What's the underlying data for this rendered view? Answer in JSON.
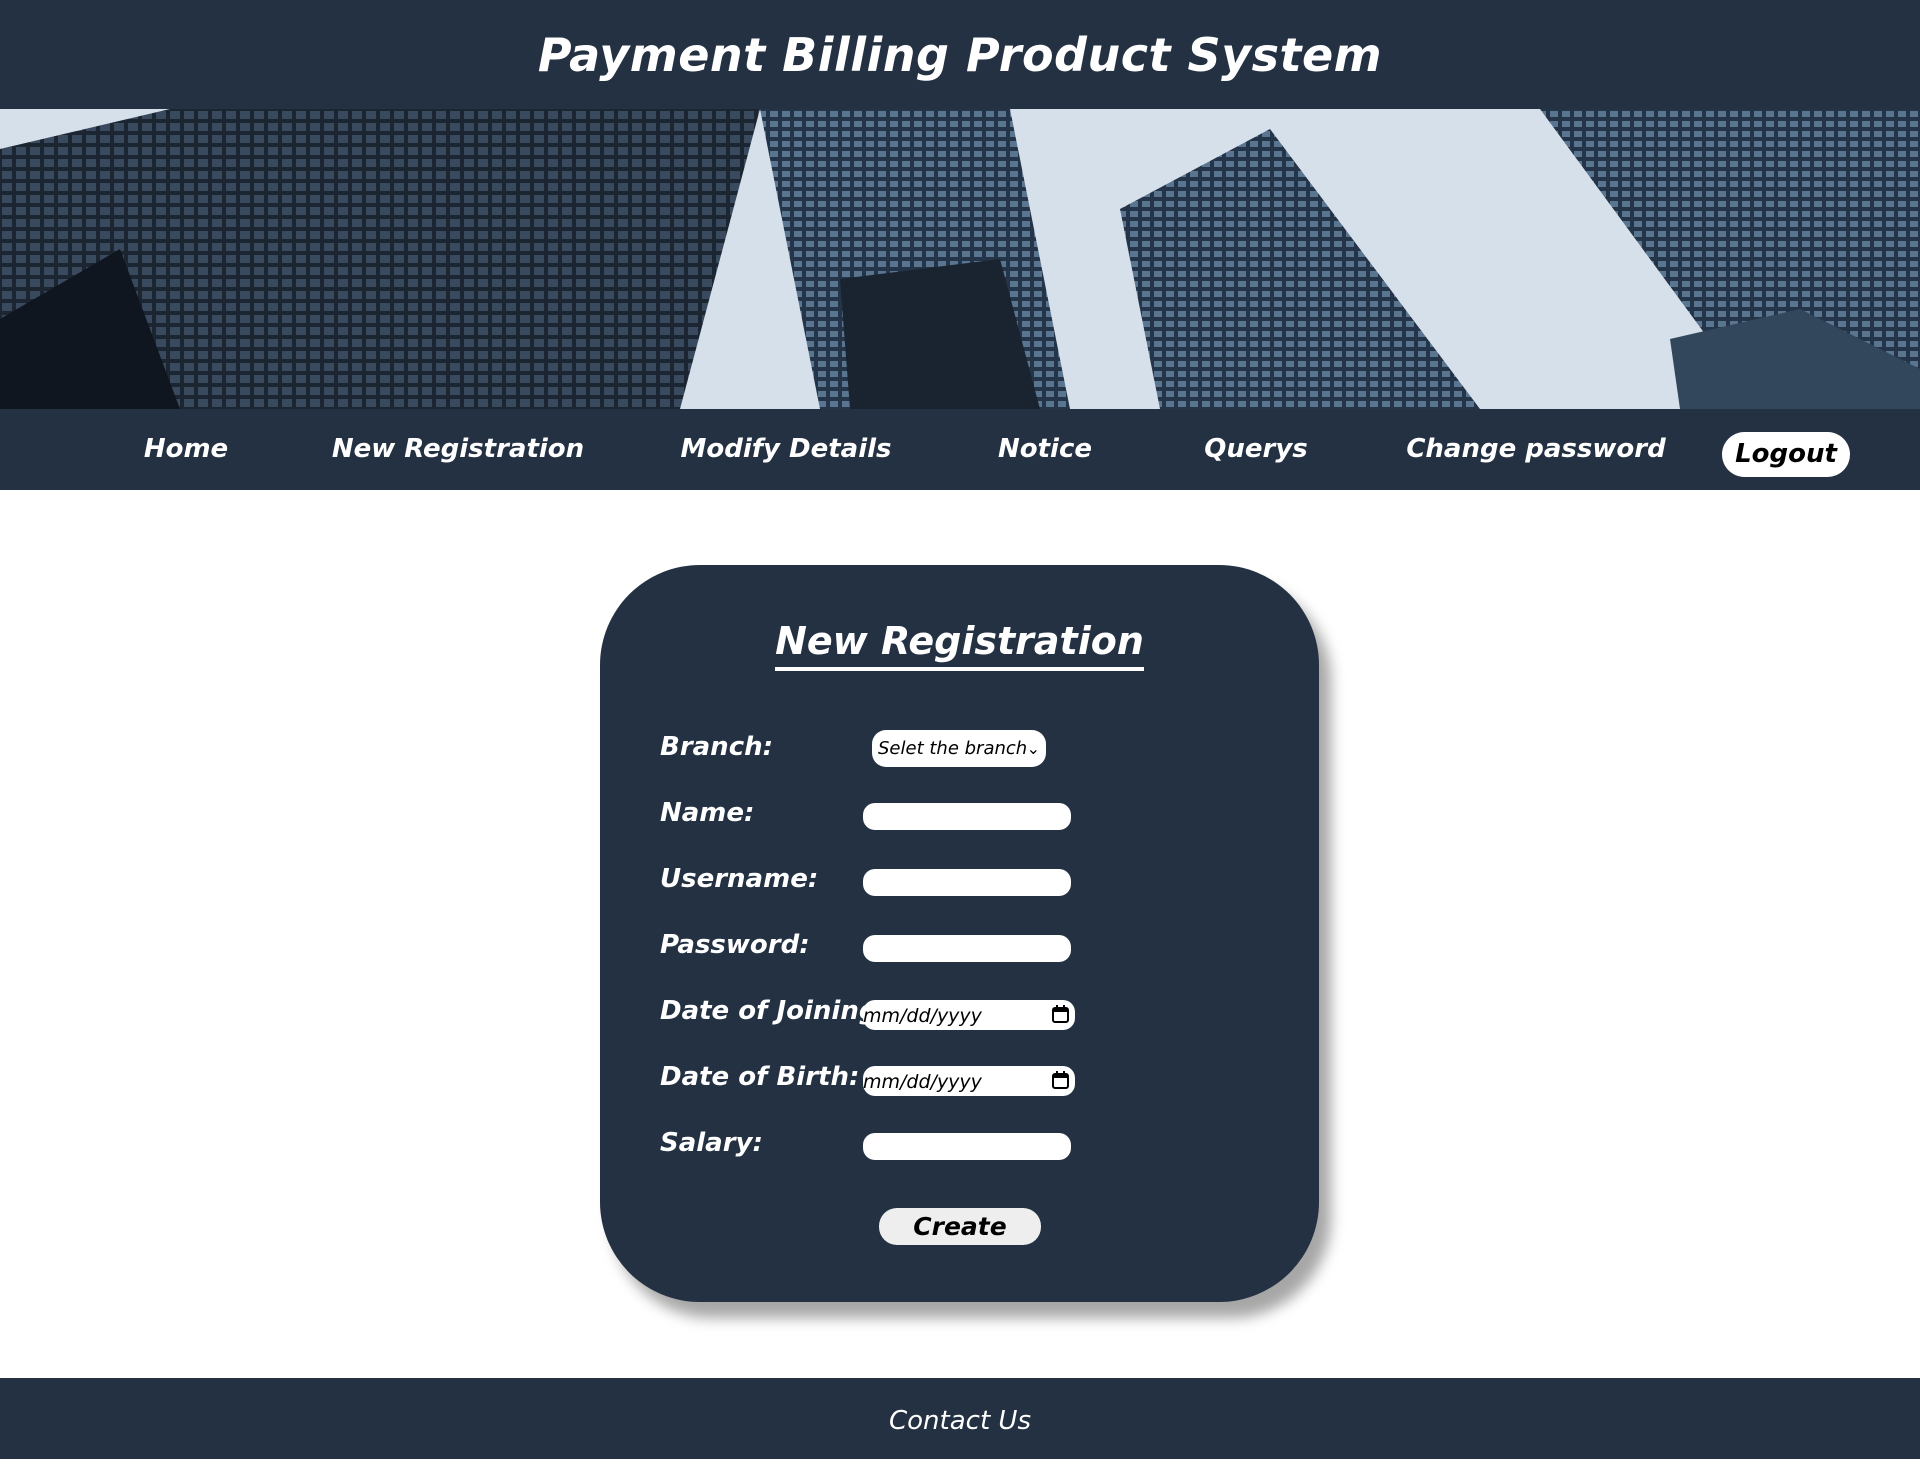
{
  "header": {
    "title": "Payment Billing Product System"
  },
  "nav": {
    "items": [
      {
        "label": "Home"
      },
      {
        "label": "New Registration"
      },
      {
        "label": "Modify Details"
      },
      {
        "label": "Notice"
      },
      {
        "label": "Querys"
      },
      {
        "label": "Change password"
      }
    ],
    "logout_label": "Logout"
  },
  "form": {
    "title": "New Registration",
    "branch_label": "Branch:",
    "branch_selected": "Selet the branch",
    "name_label": "Name:",
    "name_value": "",
    "username_label": "Username:",
    "username_value": "",
    "password_label": "Password:",
    "password_value": "",
    "doj_label": "Date of Joining:",
    "doj_placeholder": "mm/dd/yyyy",
    "dob_label": "Date of Birth:",
    "dob_placeholder": "mm/dd/yyyy",
    "salary_label": "Salary:",
    "salary_value": "",
    "create_label": "Create"
  },
  "footer": {
    "contact_label": "Contact Us"
  },
  "colors": {
    "navy": "#233142",
    "white": "#ffffff"
  }
}
